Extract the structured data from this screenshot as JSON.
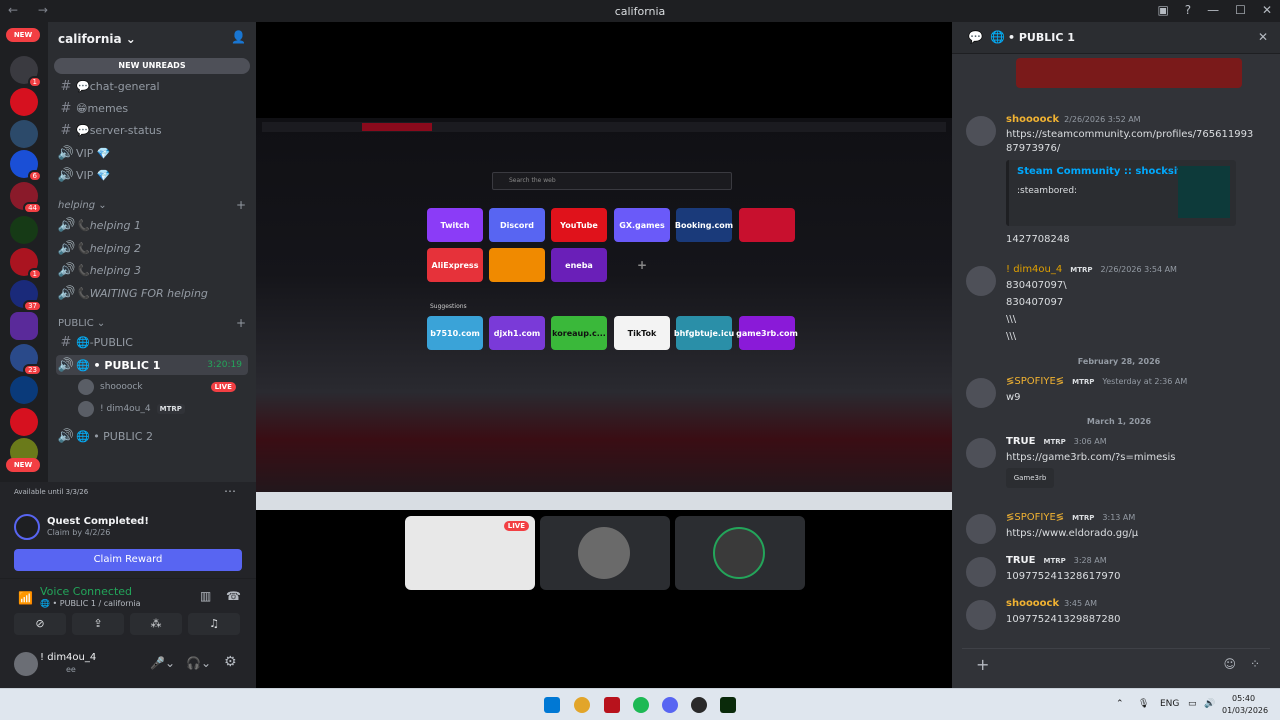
{
  "window": {
    "title": "california"
  },
  "rail": {
    "new_top": "NEW",
    "new_bottom": "NEW",
    "badges": [
      "1",
      "6",
      "44",
      "1",
      "37",
      "23"
    ]
  },
  "sidebar": {
    "server_name": "california",
    "new_unreads": "NEW UNREADS",
    "channels": [
      {
        "label": "💬chat-general"
      },
      {
        "label": "😁memes"
      },
      {
        "label": "💬server-status"
      },
      {
        "label": "VIP 💎"
      },
      {
        "label": "VIP 💎"
      }
    ],
    "cat_helping": "helping",
    "helping_channels": [
      {
        "label": "📞helping 1"
      },
      {
        "label": "📞helping 2"
      },
      {
        "label": "📞helping 3"
      },
      {
        "label": "📞WAITING FOR helping"
      }
    ],
    "cat_public": "PUBLIC",
    "public_channels": [
      {
        "label": "🌐-PUBLIC"
      },
      {
        "label": "🌐 • PUBLIC 1",
        "timer": "3:20:19"
      },
      {
        "label": "🌐 • PUBLIC 2"
      }
    ],
    "voice_users": [
      {
        "name": "shoooock",
        "badge": "LIVE"
      },
      {
        "name": "! dim4ou_4",
        "tag": "MTRP"
      }
    ]
  },
  "quest": {
    "available": "Available until 3/3/26",
    "title": "Quest Completed!",
    "claim_by": "Claim by 4/2/26",
    "button": "Claim Reward"
  },
  "voice": {
    "status": "Voice Connected",
    "channel": "🌐 • PUBLIC 1 / california"
  },
  "user": {
    "name": "! dim4ou_4",
    "sub": "ee"
  },
  "stream": {
    "search_placeholder": "Search the web",
    "tiles": [
      "Twitch",
      "Discord",
      "YouTube",
      "GX.games",
      "Booking.com",
      "",
      "AliExpress",
      "",
      "eneba",
      "+"
    ],
    "suggestions_label": "Suggestions",
    "suggestions": [
      "b7510.com",
      "djxh1.com",
      "koreaup.c...",
      "TikTok",
      "bhfgbtuje.icu",
      "game3rb.com"
    ],
    "live_badge": "LIVE"
  },
  "chat": {
    "channel": "• PUBLIC 1",
    "messages": [
      {
        "author": "shoooock",
        "time": "2/26/2026 3:52 AM",
        "link": "https://steamcommunity.com/profiles/76561199387973976/",
        "embed_title": "Steam Community :: shocksify",
        "embed_desc": ":steambored:",
        "extra": "1427708248"
      },
      {
        "author": "! dim4ou_4",
        "tag": "MTRP",
        "time": "2/26/2026 3:54 AM",
        "lines": [
          "830407097\\",
          "830407097",
          "\\\\\\",
          "\\\\\\"
        ]
      },
      {
        "divider": "February 28, 2026"
      },
      {
        "author": "≶SPOFIYE≶",
        "tag": "MTRP",
        "time": "Yesterday at 2:36 AM",
        "lines": [
          "w9"
        ]
      },
      {
        "divider": "March 1, 2026"
      },
      {
        "author": "TRUE",
        "tag": "MTRP",
        "time": "3:06 AM",
        "link": "https://game3rb.com/?s=mimesis",
        "embed_title": "Game3rb"
      },
      {
        "author": "≶SPOFIYE≶",
        "tag": "MTRP",
        "time": "3:13 AM",
        "link": "https://www.eldorado.gg/μ"
      },
      {
        "author": "TRUE",
        "tag": "MTRP",
        "time": "3:28 AM",
        "lines": [
          "1097752413286179​70"
        ]
      },
      {
        "author": "shoooock",
        "time": "3:45 AM",
        "lines": [
          "109775241329887280"
        ]
      }
    ]
  },
  "taskbar": {
    "lang": "ENG",
    "time": "05:40",
    "date": "01/03/2026"
  }
}
